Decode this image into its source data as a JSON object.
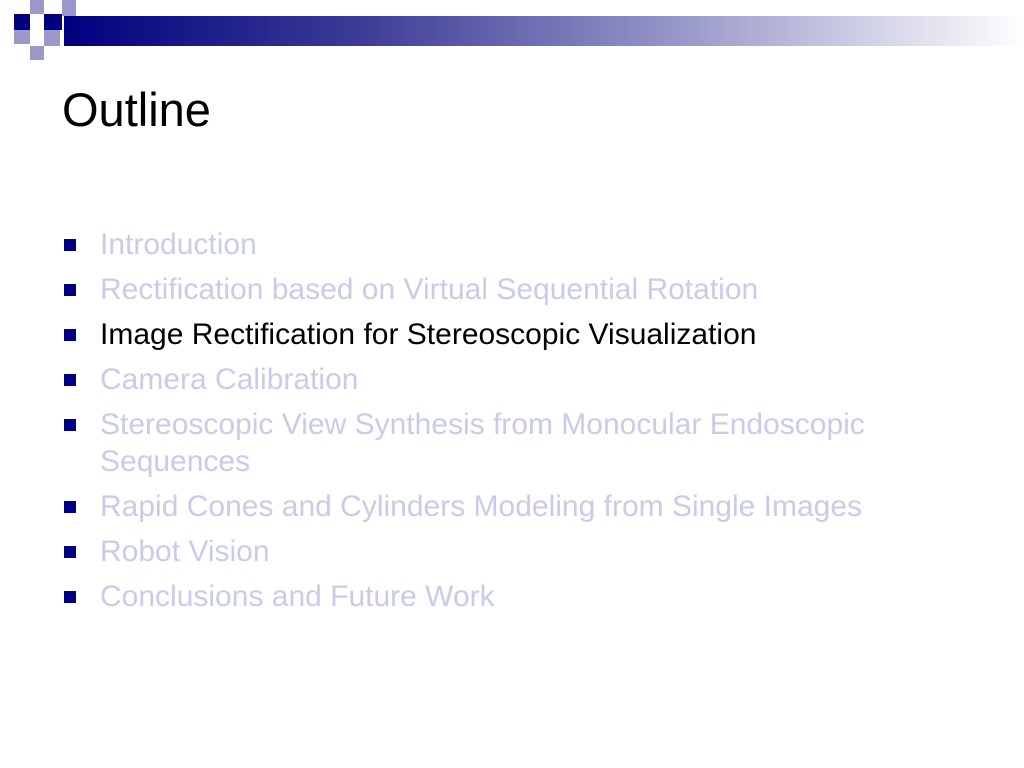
{
  "slide": {
    "title": "Outline",
    "colors": {
      "accent": "#000080",
      "mosaic_light": "#9999cc",
      "active_text": "#000000",
      "inactive_text": "#c8cce8",
      "bullet": "#000080"
    },
    "items": [
      {
        "label": "Introduction",
        "state": "inactive"
      },
      {
        "label": "Rectification based on Virtual Sequential Rotation",
        "state": "inactive"
      },
      {
        "label": "Image Rectification for Stereoscopic Visualization",
        "state": "active"
      },
      {
        "label": "Camera Calibration",
        "state": "inactive"
      },
      {
        "label": "Stereoscopic View Synthesis from Monocular Endoscopic Sequences",
        "state": "inactive"
      },
      {
        "label": "Rapid Cones and Cylinders Modeling from Single Images",
        "state": "inactive"
      },
      {
        "label": "Robot Vision",
        "state": "inactive"
      },
      {
        "label": "Conclusions and Future Work",
        "state": "inactive"
      }
    ]
  }
}
